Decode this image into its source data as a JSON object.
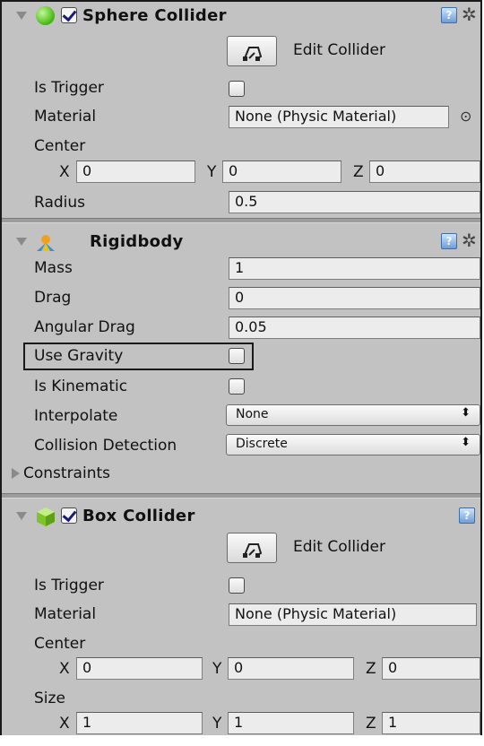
{
  "sphere_collider": {
    "title": "Sphere Collider",
    "enabled": true,
    "edit_collider_label": "Edit Collider",
    "is_trigger_label": "Is Trigger",
    "is_trigger": false,
    "material_label": "Material",
    "material_value": "None (Physic Material)",
    "center_label": "Center",
    "center": {
      "x_label": "X",
      "x": "0",
      "y_label": "Y",
      "y": "0",
      "z_label": "Z",
      "z": "0"
    },
    "radius_label": "Radius",
    "radius": "0.5"
  },
  "rigidbody": {
    "title": "Rigidbody",
    "mass_label": "Mass",
    "mass": "1",
    "drag_label": "Drag",
    "drag": "0",
    "angular_drag_label": "Angular Drag",
    "angular_drag": "0.05",
    "use_gravity_label": "Use Gravity",
    "use_gravity": false,
    "is_kinematic_label": "Is Kinematic",
    "is_kinematic": false,
    "interpolate_label": "Interpolate",
    "interpolate": "None",
    "collision_detection_label": "Collision Detection",
    "collision_detection": "Discrete",
    "constraints_label": "Constraints"
  },
  "box_collider": {
    "title": "Box Collider",
    "enabled": true,
    "edit_collider_label": "Edit Collider",
    "is_trigger_label": "Is Trigger",
    "is_trigger": false,
    "material_label": "Material",
    "material_value": "None (Physic Material)",
    "center_label": "Center",
    "center": {
      "x_label": "X",
      "x": "0",
      "y_label": "Y",
      "y": "0",
      "z_label": "Z",
      "z": "0"
    },
    "size_label": "Size",
    "size": {
      "x_label": "X",
      "x": "1",
      "y_label": "Y",
      "y": "1",
      "z_label": "Z",
      "z": "1"
    }
  },
  "icons": {
    "sphere": "sphere-collider-icon",
    "rigidbody": "rigidbody-icon",
    "box": "box-collider-icon",
    "help": "help-icon",
    "settings": "gear-icon",
    "edit_collider": "edit-collider-icon",
    "object_picker": "object-picker-icon",
    "dropdown_arrow": "updown-arrow-icon"
  },
  "colors": {
    "panel_bg": "#c2c2c2",
    "field_bg": "#ececec",
    "sphere_icon": "#5ac82a",
    "box_icon": "#8fd33a",
    "help_icon": "#6f9ed6"
  }
}
